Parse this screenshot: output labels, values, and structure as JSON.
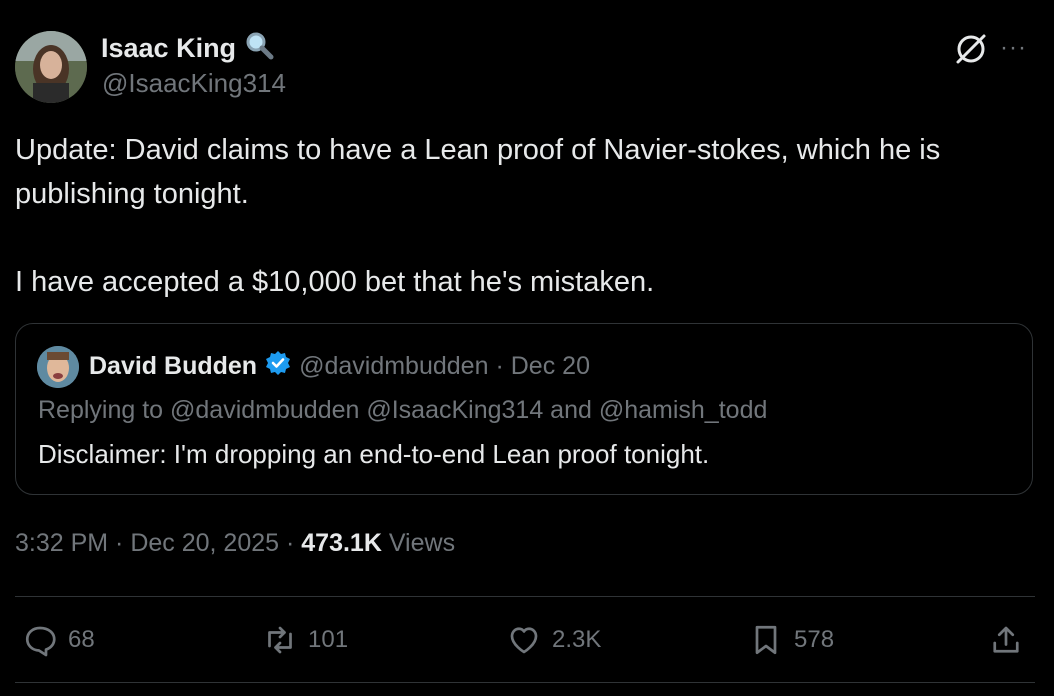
{
  "author": {
    "name": "Isaac King",
    "handle": "@IsaacKing314",
    "badge_icon": "magnifier-icon"
  },
  "tweet": {
    "text": "Update: David claims to have a Lean proof of Navier-stokes, which he is\npublishing tonight.\n\nI have accepted a $10,000 bet that he's mistaken."
  },
  "quote": {
    "name": "David Budden",
    "handle": "@davidmbudden",
    "date": "· Dec 20",
    "replying": "Replying to @davidmbudden @IsaacKing314 and @hamish_todd",
    "text": "Disclaimer: I'm dropping an end-to-end Lean proof tonight."
  },
  "meta": {
    "time": "3:32 PM · Dec 20, 2025 · ",
    "views_count": "473.1K",
    "views_label": " Views"
  },
  "actions": {
    "replies": "68",
    "reposts": "101",
    "likes": "2.3K",
    "bookmarks": "578"
  },
  "colors": {
    "background": "#000000",
    "text": "#e7e9ea",
    "muted": "#71767b",
    "border": "#2f3336",
    "verified": "#1d9bf0"
  }
}
